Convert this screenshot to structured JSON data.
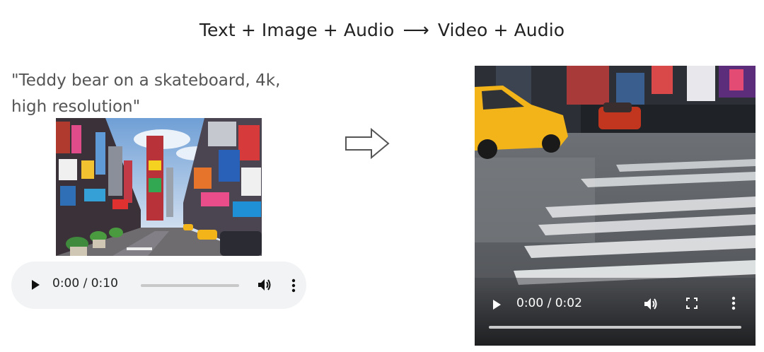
{
  "header": {
    "title_left": "Text + Image + Audio",
    "arrow": "⟶",
    "title_right": "Video + Audio"
  },
  "input": {
    "prompt_line1": "\"Teddy bear on a skateboard, 4k,",
    "prompt_line2": "high resolution\"",
    "audio_player": {
      "time": "0:00 / 0:10",
      "progress": 0,
      "icons": [
        "play-icon",
        "volume-icon",
        "more-options-icon"
      ]
    }
  },
  "output": {
    "video_player": {
      "time": "0:00 / 0:02",
      "progress": 0,
      "icons": [
        "play-icon",
        "volume-icon",
        "fullscreen-icon",
        "more-options-icon"
      ]
    }
  },
  "colors": {
    "player_bg": "#f1f3f4",
    "taxi_yellow": "#f2b418",
    "title_text": "#222222",
    "prompt_text": "#555555"
  }
}
